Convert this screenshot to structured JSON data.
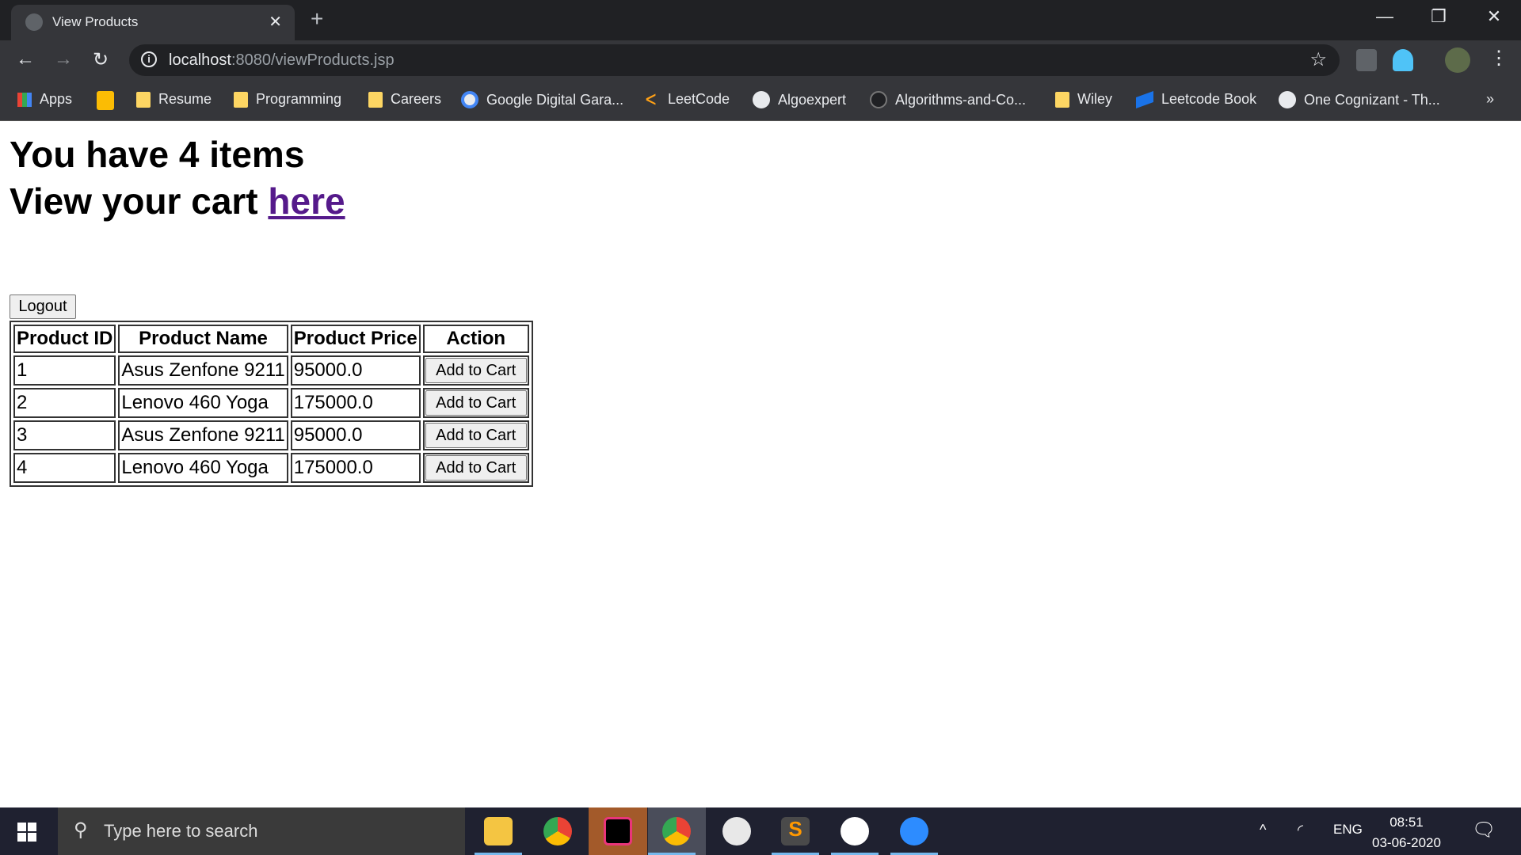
{
  "browser": {
    "tab_title": "View Products",
    "url_host": "localhost",
    "url_path": ":8080/viewProducts.jsp",
    "bookmarks": [
      "Apps",
      "Resume",
      "Programming",
      "Careers",
      "Google Digital Gara...",
      "LeetCode",
      "Algoexpert",
      "Algorithms-and-Co...",
      "Wiley",
      "Leetcode Book",
      "One Cognizant - Th..."
    ],
    "more": "»"
  },
  "page": {
    "items_line": "You have 4 items",
    "cart_line": "View your cart ",
    "cart_link": "here",
    "logout": "Logout",
    "headers": [
      "Product ID",
      "Product Name",
      "Product Price",
      "Action"
    ],
    "rows": [
      {
        "id": "1",
        "name": "Asus Zenfone 9211",
        "price": "95000.0",
        "action": "Add to Cart"
      },
      {
        "id": "2",
        "name": "Lenovo 460 Yoga",
        "price": "175000.0",
        "action": "Add to Cart"
      },
      {
        "id": "3",
        "name": "Asus Zenfone 9211",
        "price": "95000.0",
        "action": "Add to Cart"
      },
      {
        "id": "4",
        "name": "Lenovo 460 Yoga",
        "price": "175000.0",
        "action": "Add to Cart"
      }
    ]
  },
  "taskbar": {
    "search_placeholder": "Type here to search",
    "lang": "ENG",
    "time": "08:51",
    "date": "03-06-2020"
  }
}
